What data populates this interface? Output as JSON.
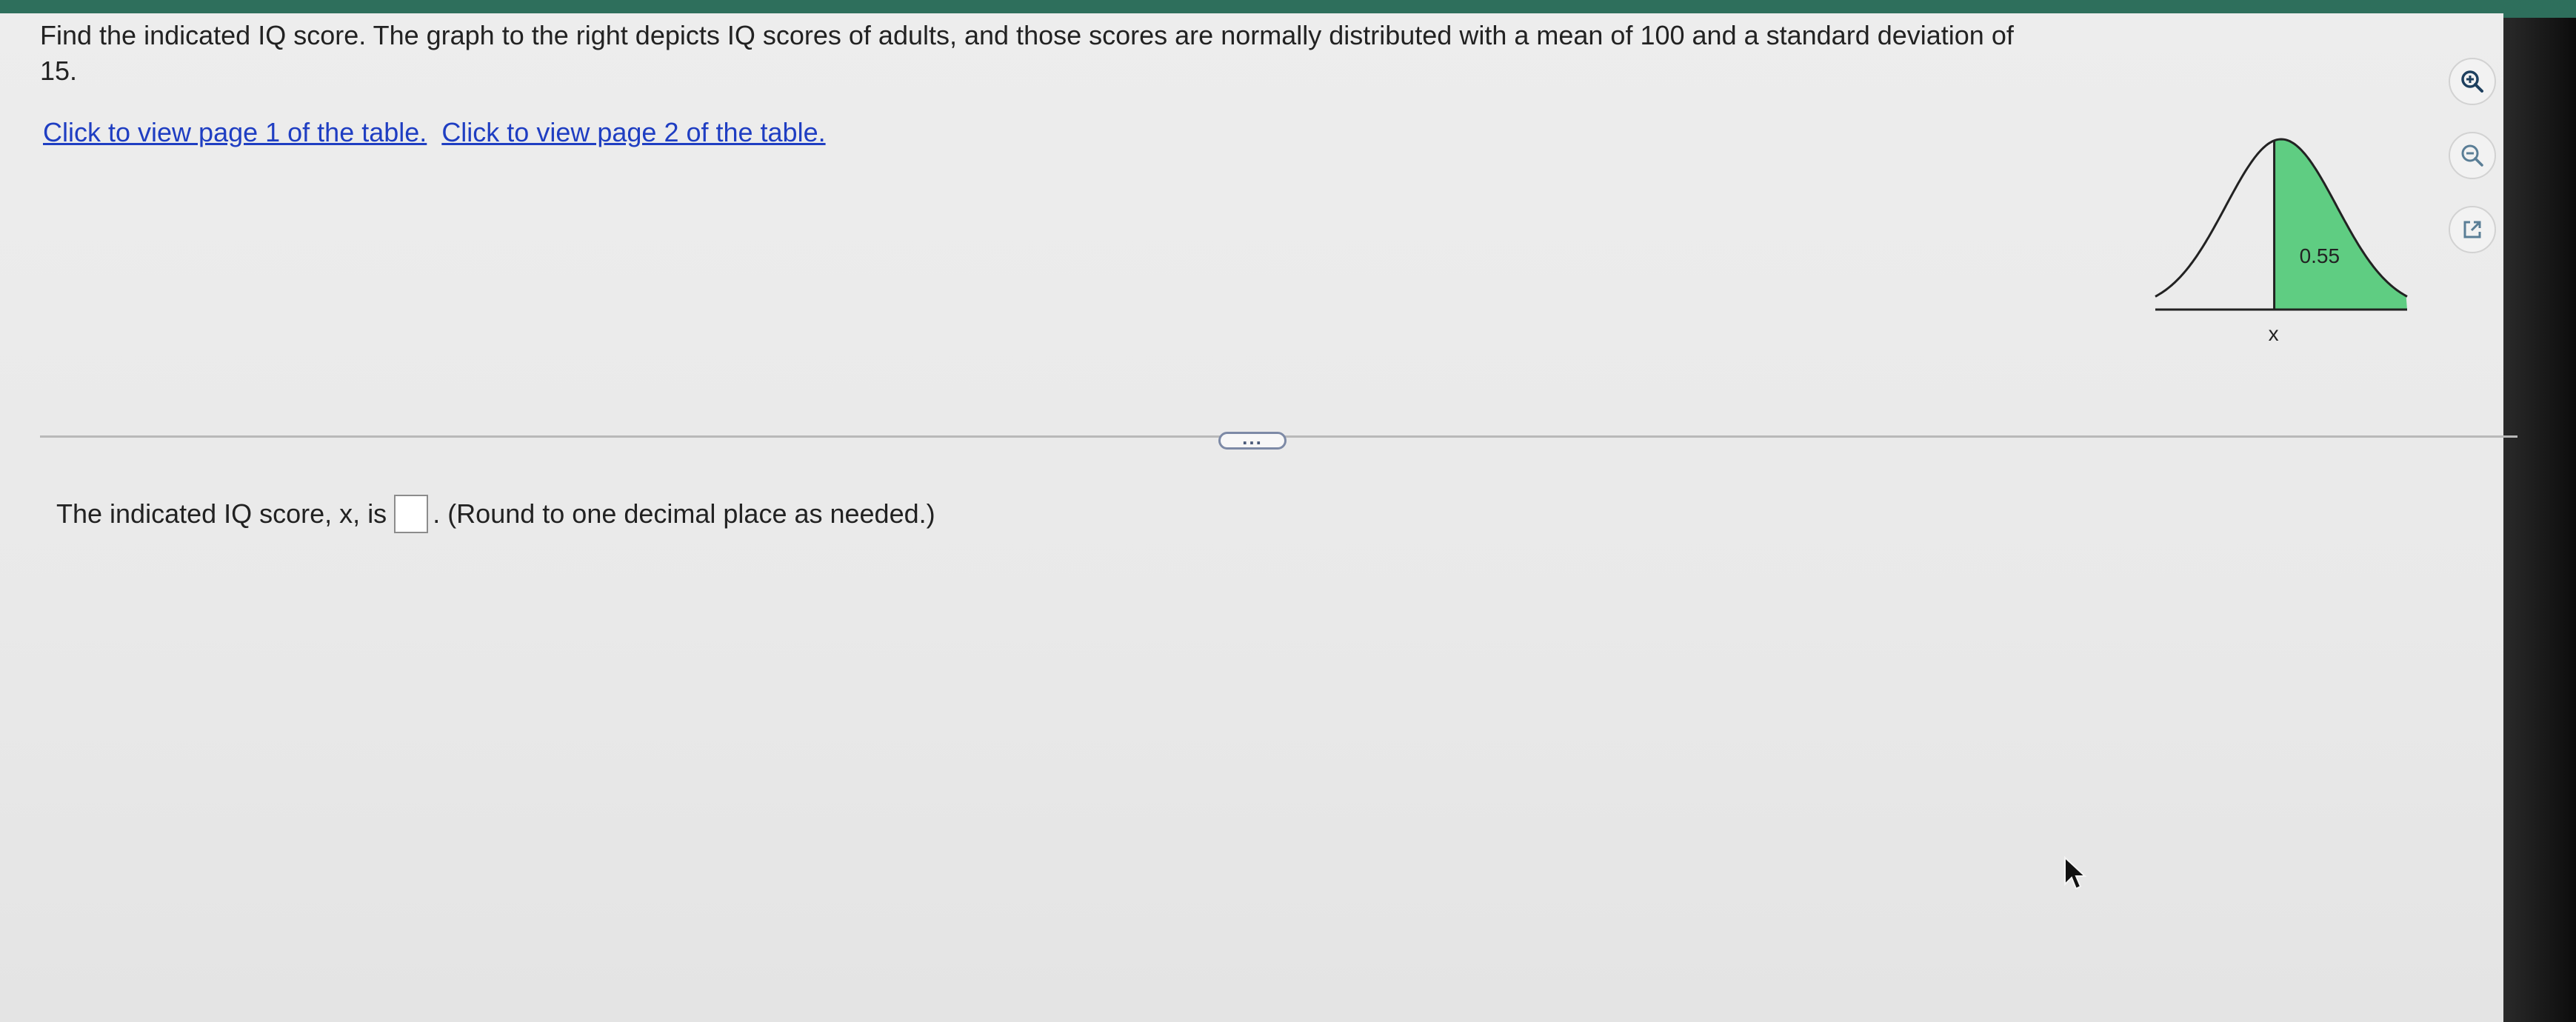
{
  "question": {
    "text": "Find the indicated IQ score. The graph to the right depicts IQ scores of adults, and those scores are normally distributed with a mean of 100 and a standard deviation of 15."
  },
  "links": {
    "page1": "Click to view page 1 of the table.",
    "page2": "Click to view page 2 of the table."
  },
  "graph": {
    "shaded_area_label": "0.55",
    "x_label": "x",
    "shaded_area": 0.55,
    "shaded_side": "right",
    "fill_color": "#5fcd82"
  },
  "tools": {
    "zoom_in": "zoom-in-icon",
    "zoom_out": "zoom-out-icon",
    "popout": "popout-icon"
  },
  "divider": {
    "handle_label": "..."
  },
  "answer": {
    "prefix": "The indicated IQ score, x, is",
    "suffix": ". (Round to one decimal place as needed.)",
    "value": ""
  }
}
